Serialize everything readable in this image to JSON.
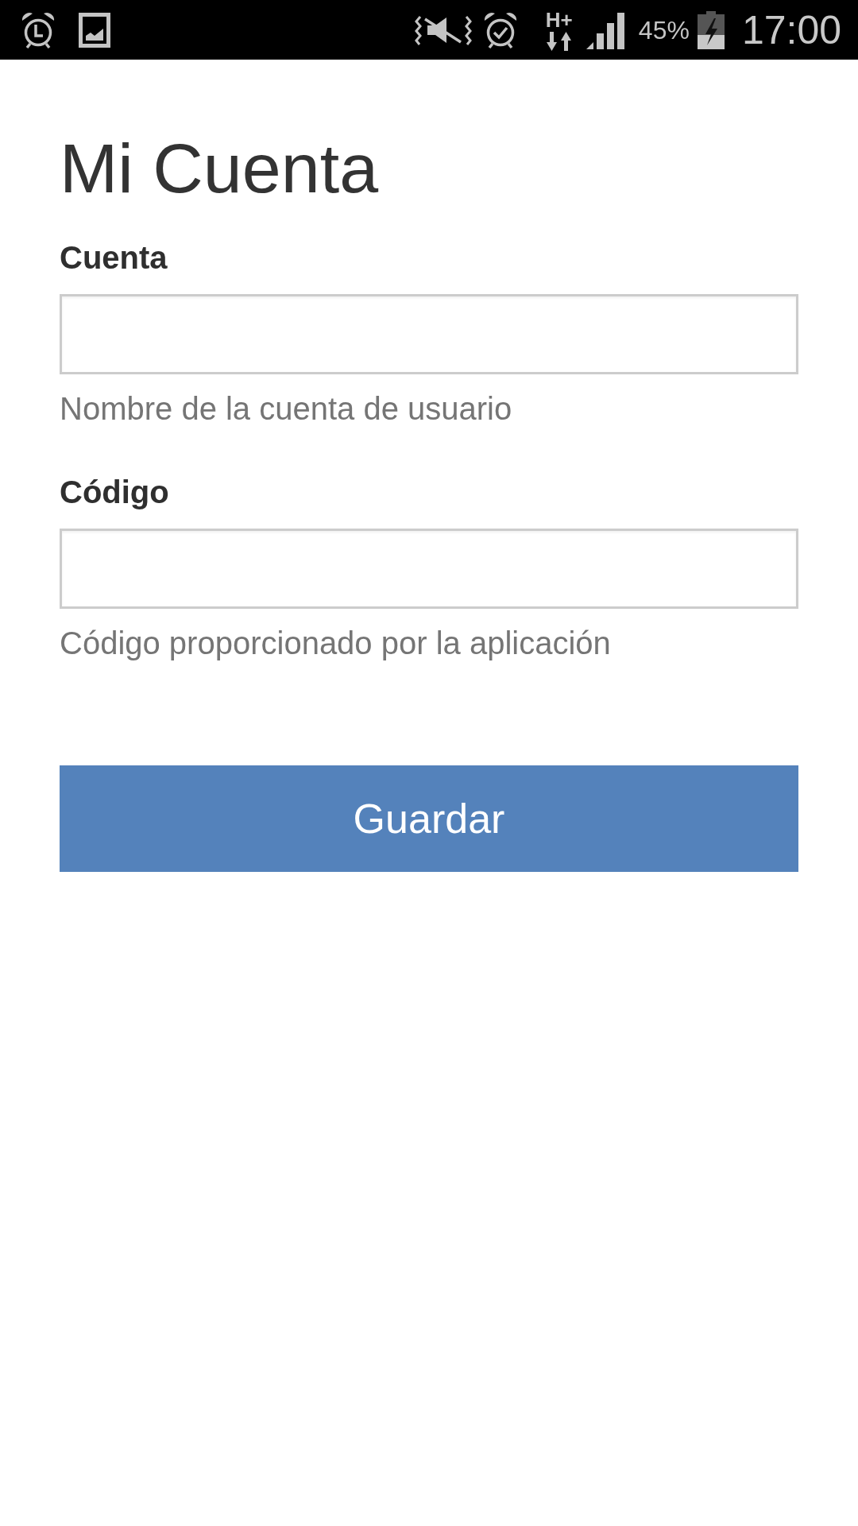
{
  "status_bar": {
    "network": "H+",
    "battery": "45%",
    "time": "17:00"
  },
  "title": "Mi Cuenta",
  "fields": [
    {
      "label": "Cuenta",
      "helper": "Nombre de la cuenta de usuario"
    },
    {
      "label": "Código",
      "helper": "Código proporcionado por la aplicación"
    }
  ],
  "save_button": {
    "label": "Guardar"
  }
}
